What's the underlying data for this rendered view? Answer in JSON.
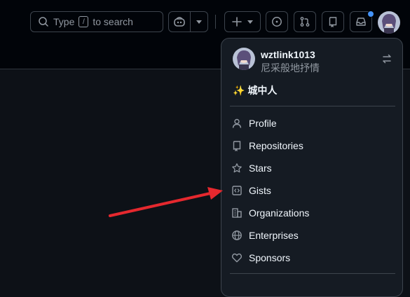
{
  "search": {
    "placeholder_before": "Type",
    "slash": "/",
    "placeholder_after": "to search"
  },
  "menu": {
    "username": "wztlink1013",
    "fullname": "尼采般地抒情",
    "status_emoji": "✨",
    "status_text": "城中人",
    "items": [
      {
        "label": "Profile",
        "icon": "person-icon"
      },
      {
        "label": "Repositories",
        "icon": "repo-icon"
      },
      {
        "label": "Stars",
        "icon": "star-icon"
      },
      {
        "label": "Gists",
        "icon": "code-square-icon"
      },
      {
        "label": "Organizations",
        "icon": "organization-icon"
      },
      {
        "label": "Enterprises",
        "icon": "globe-icon"
      },
      {
        "label": "Sponsors",
        "icon": "heart-icon"
      }
    ]
  },
  "colors": {
    "annotation_arrow": "#e5282e",
    "notification_dot": "#4493f8"
  }
}
